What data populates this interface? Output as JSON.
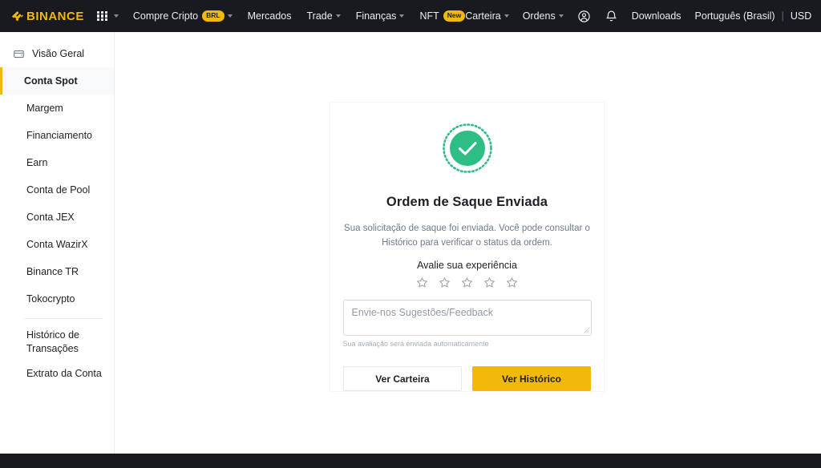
{
  "header": {
    "brand": "BINANCE",
    "apps_icon": "grid-apps-icon",
    "nav_items": [
      {
        "label": "Compre Cripto",
        "badge": "BRL",
        "caret": true
      },
      {
        "label": "Mercados",
        "badge": "",
        "caret": false
      },
      {
        "label": "Trade",
        "badge": "",
        "caret": true
      },
      {
        "label": "Finanças",
        "badge": "",
        "caret": true
      },
      {
        "label": "NFT",
        "badge": "New",
        "caret": false
      }
    ],
    "right_items": [
      {
        "label": "Carteira",
        "caret": true
      },
      {
        "label": "Ordens",
        "caret": true
      }
    ],
    "profile_icon": "user-circle-icon",
    "bell_icon": "bell-icon",
    "downloads": "Downloads",
    "language": "Português (Brasil)",
    "separator": "|",
    "currency": "USD"
  },
  "sidebar": {
    "items": [
      {
        "label": "Visão Geral",
        "icon": "wallet-icon",
        "active": false
      },
      {
        "label": "Conta Spot",
        "icon": "",
        "active": true
      },
      {
        "label": "Margem",
        "icon": "",
        "active": false
      },
      {
        "label": "Financiamento",
        "icon": "",
        "active": false
      },
      {
        "label": "Earn",
        "icon": "",
        "active": false
      },
      {
        "label": "Conta de Pool",
        "icon": "",
        "active": false
      },
      {
        "label": "Conta JEX",
        "icon": "",
        "active": false
      },
      {
        "label": "Conta WazirX",
        "icon": "",
        "active": false
      },
      {
        "label": "Binance TR",
        "icon": "",
        "active": false
      },
      {
        "label": "Tokocrypto",
        "icon": "",
        "active": false
      }
    ],
    "items_after_divider": [
      {
        "label": "Histórico de Transações"
      },
      {
        "label": "Extrato da Conta"
      }
    ]
  },
  "card": {
    "status_icon": "success-check-icon",
    "title": "Ordem de Saque Enviada",
    "description": "Sua solicitação de saque foi enviada. Você pode consultar o Histórico para verificar o status da ordem.",
    "rating_label": "Avalie sua experiência",
    "stars": {
      "total": 5,
      "selected": 0,
      "icon": "star-outline-icon"
    },
    "feedback_placeholder": "Envie-nos Sugestões/Feedback",
    "feedback_value": "",
    "hint": "Sua avaliação será enviada automaticamente",
    "secondary_button": "Ver Carteira",
    "primary_button": "Ver Histórico"
  },
  "colors": {
    "brand_yellow": "#f0b90b",
    "success_green": "#2ebd85",
    "nav_dark": "#181a20",
    "text_primary": "#1e2026",
    "text_muted": "#707a8a"
  }
}
